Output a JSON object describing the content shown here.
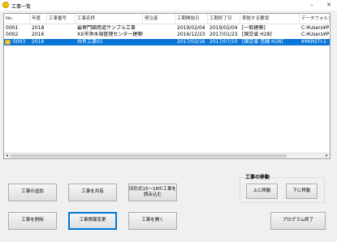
{
  "window": {
    "title": "工事一覧"
  },
  "table": {
    "columns": [
      "No.",
      "年度",
      "工事番号",
      "工事名称",
      "発注者",
      "工期開始日",
      "工期終了日",
      "準拠する要領",
      "データフォルダ"
    ],
    "rows": [
      [
        "0001",
        "2018",
        "",
        "最寄門國用道サンプル工事",
        "",
        "2019/02/04",
        "2019/02/04",
        "[一般建築]",
        "C:¥Users¥P"
      ],
      [
        "0002",
        "2016",
        "",
        "XX市浄水場管理センター建築物",
        "",
        "2016/12/23",
        "2017/01/23",
        "[国交省 H28]",
        "C:¥Users¥P"
      ],
      [
        "0003",
        "2016",
        "",
        "共有工事01",
        "",
        "2017/02/16",
        "2017/07/10",
        "[国交省 営繕 H28]",
        "¥¥KRSTI-1"
      ]
    ]
  },
  "buttons": {
    "add": "工事の追加",
    "share": "工事を共有",
    "load_old": "旧形式15～18の工事を読み込む",
    "delete": "工事を削除",
    "change_info": "工事情報変更",
    "open": "工事を開く",
    "move_up": "上に移動",
    "move_down": "下に移動",
    "exit": "プログラム終了"
  },
  "move_group": {
    "title": "工事の移動"
  }
}
